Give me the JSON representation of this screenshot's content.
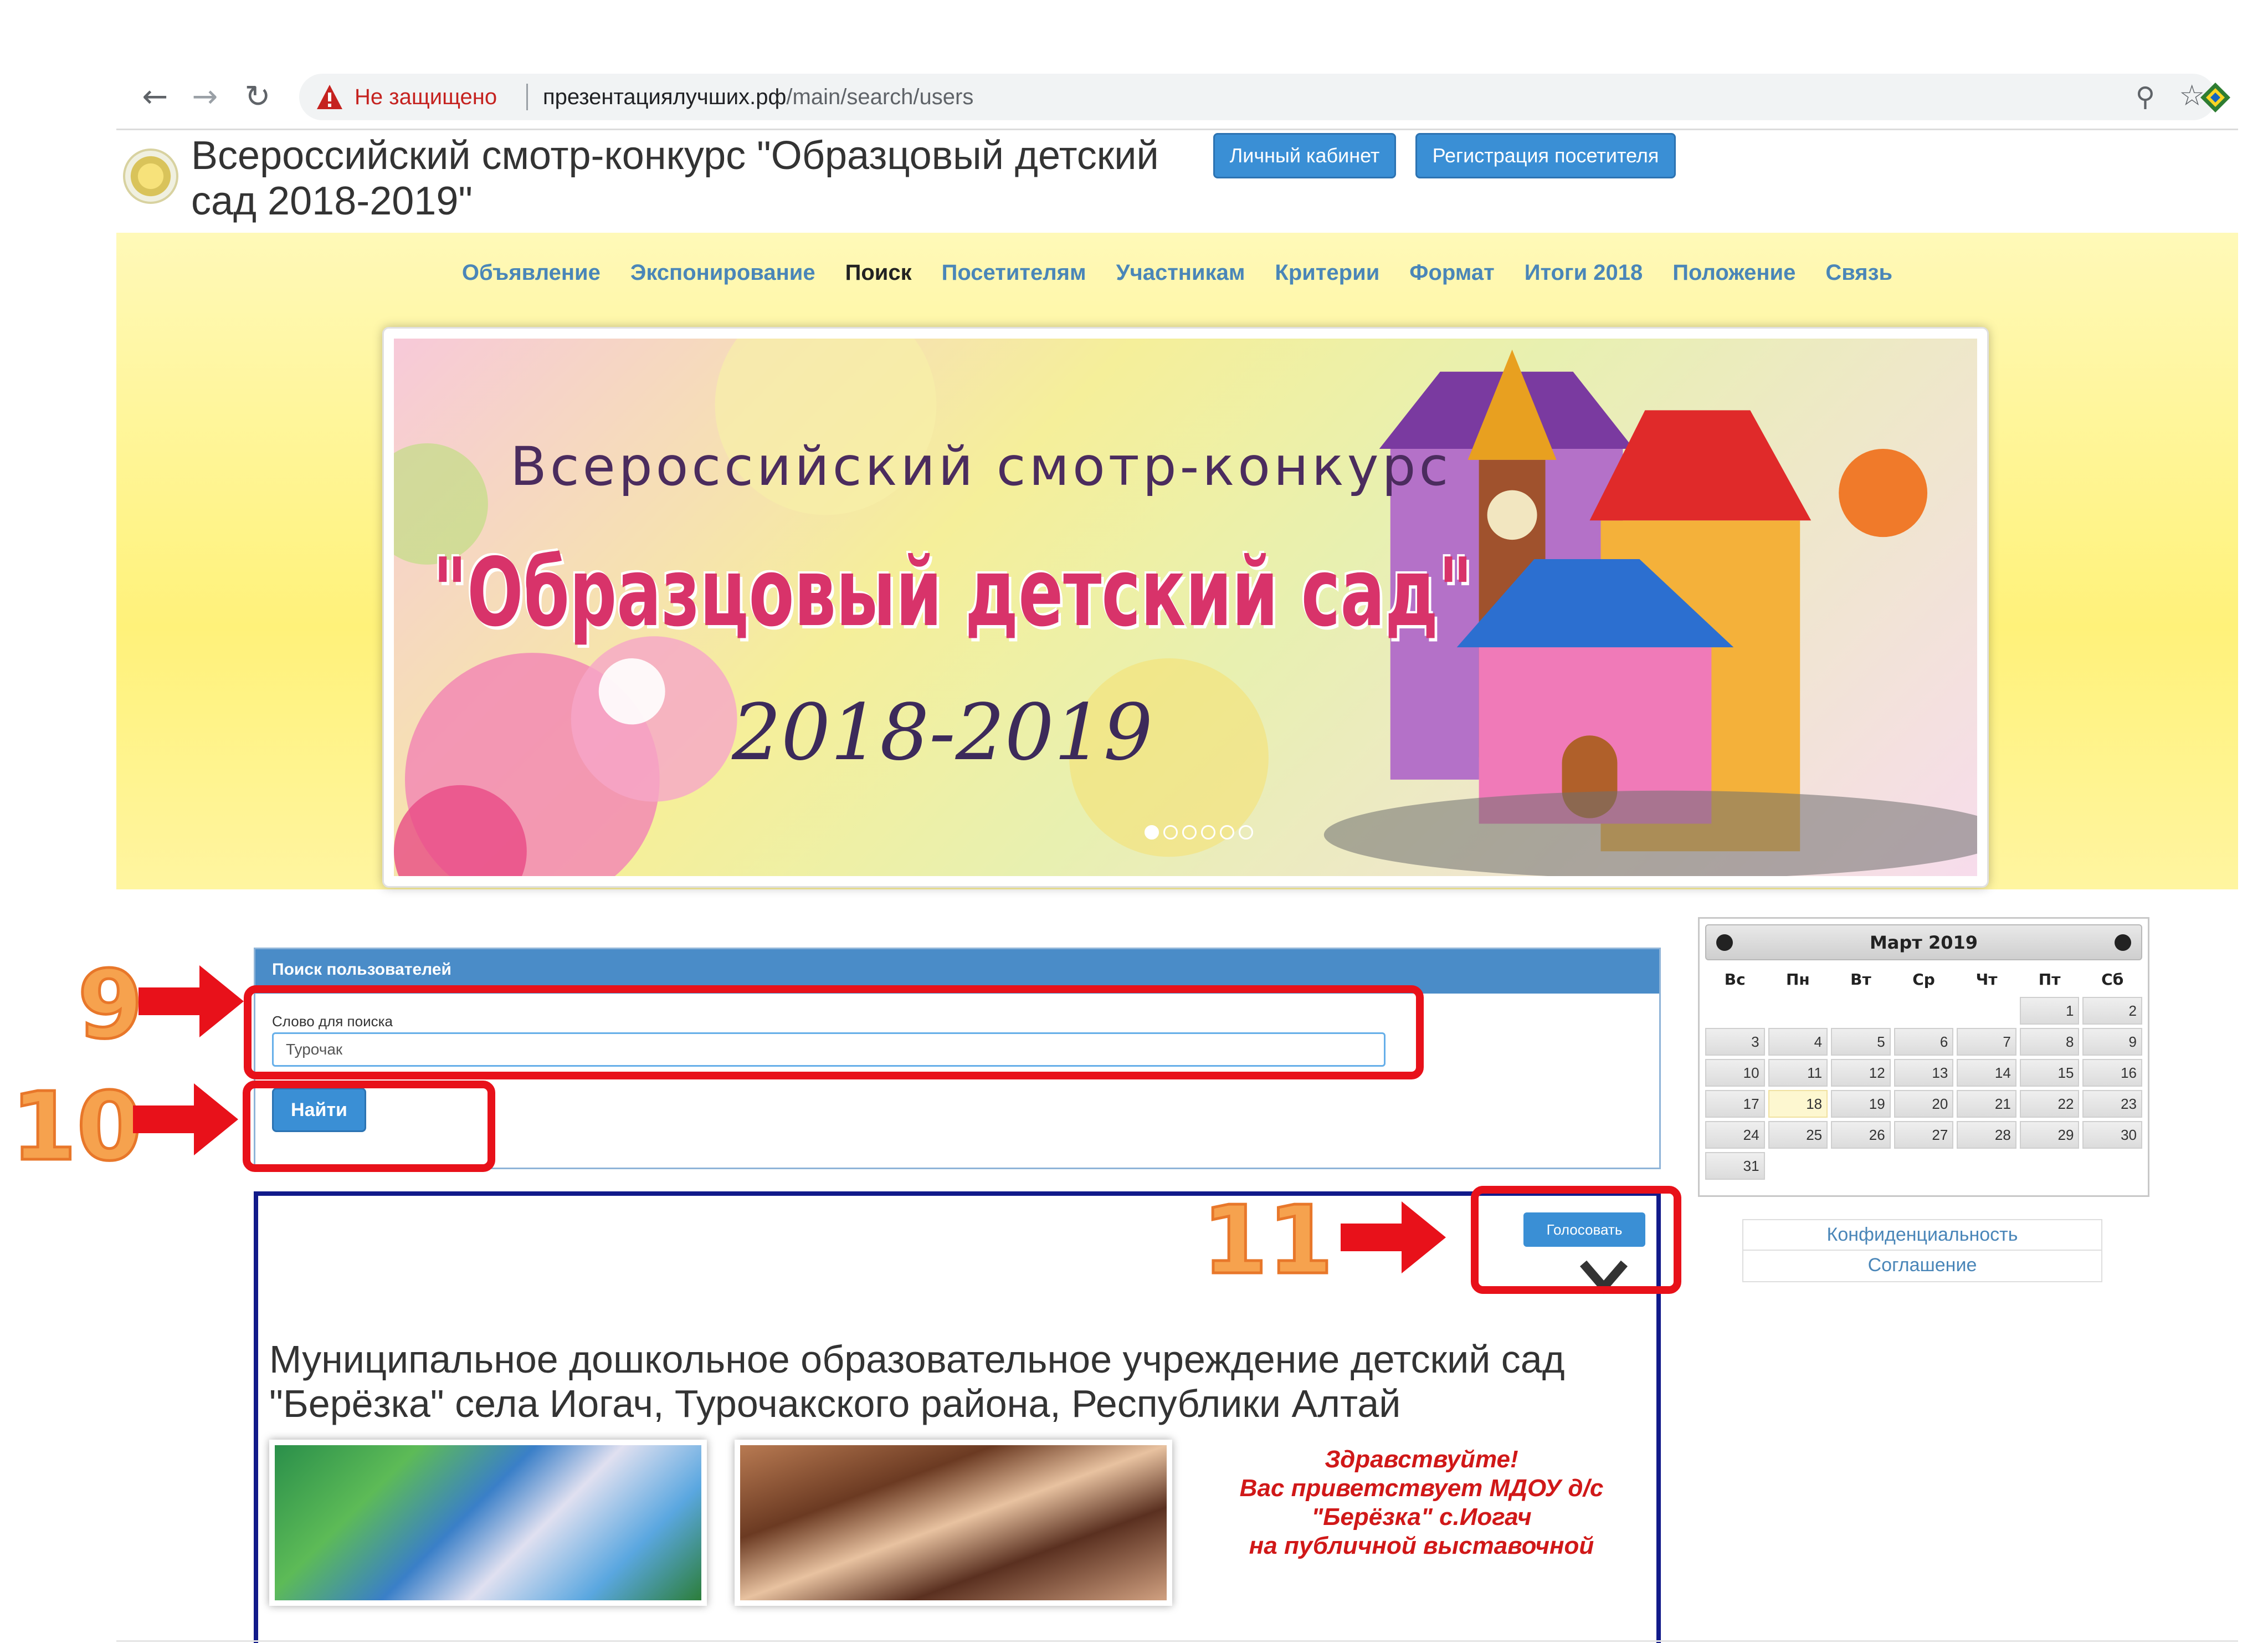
{
  "browser": {
    "insecure_label": "Не защищено",
    "url_domain": "презентациялучших.рф",
    "url_path": "/main/search/users",
    "icons": {
      "back": "arrow-left-icon",
      "forward": "arrow-right-icon",
      "reload": "reload-icon",
      "warning": "warning-triangle-icon",
      "zoom": "zoom-icon",
      "bookmark": "star-icon",
      "extension": "extension-icon"
    }
  },
  "header": {
    "title": "Всероссийский смотр-конкурс \"Образцовый детский сад 2018-2019\"",
    "cabinet_label": "Личный кабинет",
    "register_label": "Регистрация посетителя"
  },
  "nav": {
    "items": [
      {
        "label": "Объявление",
        "active": false
      },
      {
        "label": "Экспонирование",
        "active": false
      },
      {
        "label": "Поиск",
        "active": true
      },
      {
        "label": "Посетителям",
        "active": false
      },
      {
        "label": "Участникам",
        "active": false
      },
      {
        "label": "Критерии",
        "active": false
      },
      {
        "label": "Формат",
        "active": false
      },
      {
        "label": "Итоги 2018",
        "active": false
      },
      {
        "label": "Положение",
        "active": false
      },
      {
        "label": "Связь",
        "active": false
      }
    ]
  },
  "banner": {
    "line1": "Всероссийский смотр-конкурс",
    "line2": "\"Образцовый детский сад\"",
    "line3": "2018-2019",
    "slide_count": 6,
    "active_slide": 1
  },
  "search": {
    "panel_title": "Поиск пользователей",
    "field_label": "Слово для поиска",
    "field_value": "Турочак",
    "find_label": "Найти"
  },
  "result": {
    "vote_label": "Голосовать",
    "org_title": "Муниципальное дошкольное образовательное учреждение детский сад \"Берёзка\" села Иогач, Турочакского района, Республики Алтай",
    "welcome_lines": [
      "Здравствуйте!",
      "Вас приветствует МДОУ д/с",
      "\"Берёзка\" с.Иогач",
      "на публичной выставочной"
    ]
  },
  "calendar": {
    "title": "Март 2019",
    "weekdays": [
      "Вс",
      "Пн",
      "Вт",
      "Ср",
      "Чт",
      "Пт",
      "Сб"
    ],
    "leading_blanks": 5,
    "days_in_month": 31,
    "today": 18
  },
  "side_links": [
    "Конфиденциальность",
    "Соглашение"
  ],
  "annotations": {
    "step9": "9",
    "step10": "10",
    "step11": "11"
  },
  "colors": {
    "accent_blue": "#3a8fd5",
    "highlight_red": "#e8111a",
    "step_orange": "#f6a24e",
    "card_border": "#111a8a"
  }
}
